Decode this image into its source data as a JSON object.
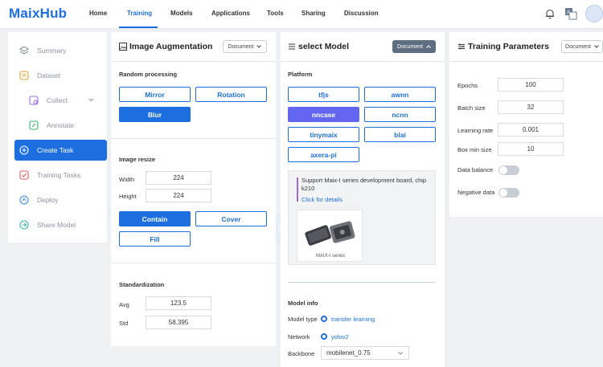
{
  "brand": {
    "logo": "MaixHub"
  },
  "nav": {
    "items": [
      {
        "label": "Home"
      },
      {
        "label": "Training"
      },
      {
        "label": "Models"
      },
      {
        "label": "Applications"
      },
      {
        "label": "Tools"
      },
      {
        "label": "Sharing"
      },
      {
        "label": "Discussion"
      }
    ],
    "active": "Training"
  },
  "sidebar": {
    "items": [
      {
        "label": "Summary",
        "icon": "summary-icon"
      },
      {
        "label": "Dataset",
        "icon": "dataset-icon"
      },
      {
        "label": "Collect",
        "icon": "collect-icon"
      },
      {
        "label": "Annotate",
        "icon": "annotate-icon"
      },
      {
        "label": "Create Task",
        "icon": "create-task-icon"
      },
      {
        "label": "Training Tasks",
        "icon": "training-tasks-icon"
      },
      {
        "label": "Deploy",
        "icon": "deploy-icon"
      },
      {
        "label": "Share Model",
        "icon": "share-model-icon"
      }
    ],
    "active": "Create Task"
  },
  "augmentation": {
    "title": "Image Augmentation",
    "doc_label": "Document",
    "random_processing_label": "Random processing",
    "random_options": [
      "Mirror",
      "Rotation",
      "Blur"
    ],
    "random_selected": "Blur",
    "image_resize_label": "Image resize",
    "width_label": "Width",
    "width_value": "224",
    "height_label": "Height",
    "height_value": "224",
    "resize_modes": [
      "Contain",
      "Cover",
      "Fill"
    ],
    "resize_selected": "Contain",
    "standardization_label": "Standardization",
    "avg_label": "Avg",
    "avg_value": "123.5",
    "std_label": "Std",
    "std_value": "58.395"
  },
  "model": {
    "title": "select Model",
    "doc_label": "Document",
    "platform_label": "Platform",
    "platforms": [
      "tfjs",
      "awnn",
      "nncase",
      "ncnn",
      "tinymaix",
      "blai",
      "axera-pi"
    ],
    "platform_selected": "nncase",
    "info_text": "Support Maix-I series development board, chip k210",
    "info_link": "Click for details",
    "device_caption": "MAIX-I series",
    "model_info_label": "Model info",
    "model_type_label": "Model type",
    "model_type_value": "transfer learning",
    "network_label": "Network",
    "network_value": "yolov2",
    "backbone_label": "Backbone",
    "backbone_value": "mobilenet_0.75"
  },
  "training": {
    "title": "Training Parameters",
    "doc_label": "Document",
    "epochs_label": "Epochs",
    "epochs_value": "100",
    "batch_label": "Batch size",
    "batch_value": "32",
    "lr_label": "Learning rate",
    "lr_value": "0.001",
    "box_label": "Box min size",
    "box_value": "10",
    "balance_label": "Data balance",
    "balance_on": false,
    "negative_label": "Negative data",
    "negative_on": false
  },
  "colors": {
    "accent": "#1d6fe0",
    "selected_platform": "#6366f1"
  }
}
